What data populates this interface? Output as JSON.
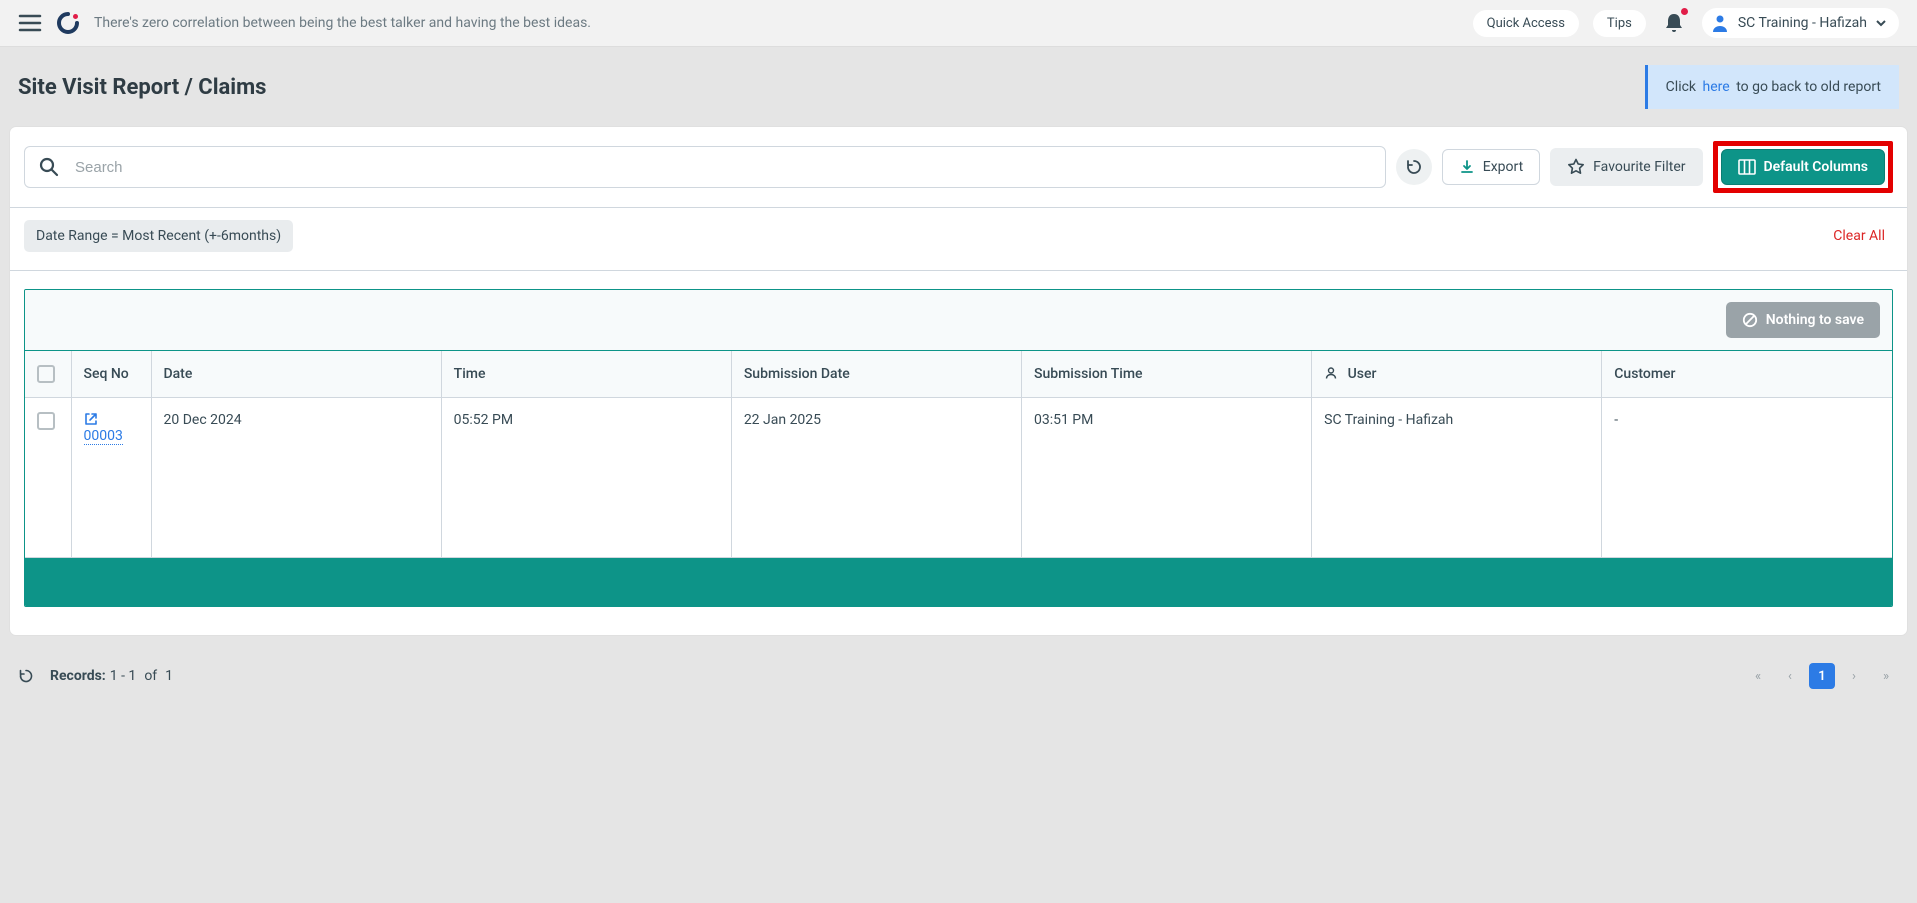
{
  "topbar": {
    "quote": "There's zero correlation between being the best talker and having the best ideas.",
    "quick_access": "Quick Access",
    "tips": "Tips",
    "user_name": "SC Training - Hafizah"
  },
  "page": {
    "title": "Site Visit Report / Claims",
    "notice_prefix": "Click",
    "notice_link": "here",
    "notice_suffix": "to go back to old report"
  },
  "toolbar": {
    "search_placeholder": "Search",
    "export": "Export",
    "favourite": "Favourite Filter",
    "default_columns": "Default Columns"
  },
  "filters": {
    "date_range_chip": "Date Range  =  Most Recent (+-6months)",
    "clear_all": "Clear All"
  },
  "save_bar": {
    "nothing_to_save": "Nothing to save"
  },
  "table": {
    "headers": {
      "seq_no": "Seq No",
      "date": "Date",
      "time": "Time",
      "submission_date": "Submission Date",
      "submission_time": "Submission Time",
      "user": "User",
      "customer": "Customer"
    },
    "rows": [
      {
        "seq_no": "00003",
        "date": "20 Dec 2024",
        "time": "05:52 PM",
        "submission_date": "22 Jan 2025",
        "submission_time": "03:51 PM",
        "user": "SC Training - Hafizah",
        "customer": "-"
      }
    ]
  },
  "footer": {
    "records_label": "Records:",
    "records_range": "1 - 1",
    "records_of": "of",
    "records_total": "1",
    "page_current": "1"
  }
}
